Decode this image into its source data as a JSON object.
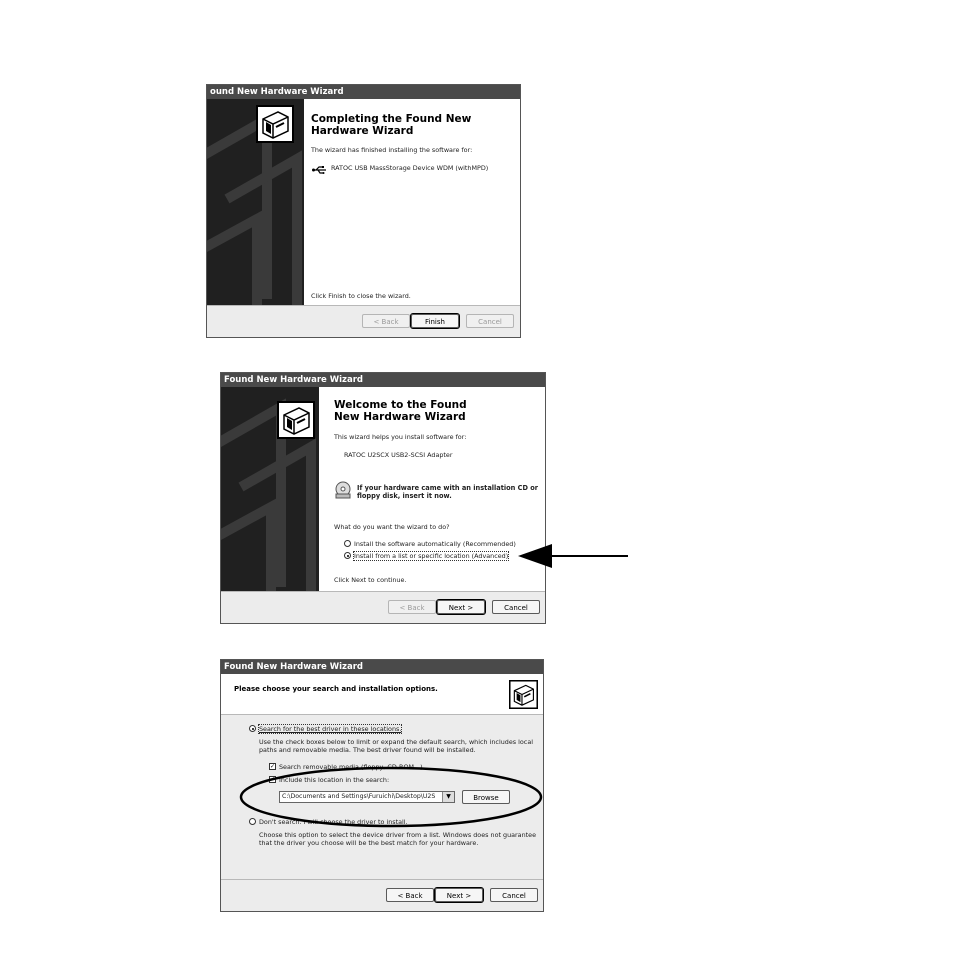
{
  "wizard1": {
    "title": "ound New Hardware Wizard",
    "heading": "Completing the Found New Hardware Wizard",
    "line1": "The wizard has finished installing the software for:",
    "device": "RATOC USB MassStorage Device WDM (withMPD)",
    "footer_text": "Click Finish to close the wizard.",
    "btn_back": "< Back",
    "btn_finish": "Finish",
    "btn_cancel": "Cancel"
  },
  "wizard2": {
    "title": "Found New Hardware Wizard",
    "heading": "Welcome to the Found New Hardware Wizard",
    "line1": "This wizard helps you install software for:",
    "device": "RATOC U2SCX USB2-SCSI Adapter",
    "cd_note": "If your hardware came with an installation CD or floppy disk, insert it now.",
    "question": "What do you want the wizard to do?",
    "option_auto": "Install the software automatically (Recommended)",
    "option_list": "Install from a list or specific location (Advanced)",
    "continue_text": "Click Next to continue.",
    "btn_back": "< Back",
    "btn_next": "Next >",
    "btn_cancel": "Cancel"
  },
  "wizard3": {
    "title": "Found New Hardware Wizard",
    "heading": "Please choose your search and installation options.",
    "option_search": "Search for the best driver in these locations.",
    "search_desc": "Use the check boxes below to limit or expand the default search, which includes local paths and removable media. The best driver found will be installed.",
    "check_removable": "Search removable media (floppy, CD-ROM...)",
    "check_include": "Include this location in the search:",
    "path_value": "C:\\Documents and Settings\\Furuichi\\Desktop\\U2S",
    "btn_browse": "Browse",
    "option_dont": "Don't search. I will choose the driver to install.",
    "dont_desc": "Choose this option to select the device driver from a list. Windows does not guarantee that the driver you choose will be the best match for your hardware.",
    "btn_back": "< Back",
    "btn_next": "Next >",
    "btn_cancel": "Cancel"
  },
  "colors": {
    "titlebar": "#4a4a4a",
    "panel": "#202020",
    "window_bg": "#ececec"
  },
  "icons": [
    "hardware-wizard-icon",
    "usb-icon",
    "cd-icon",
    "arrow-pointer",
    "ellipse-highlight"
  ]
}
